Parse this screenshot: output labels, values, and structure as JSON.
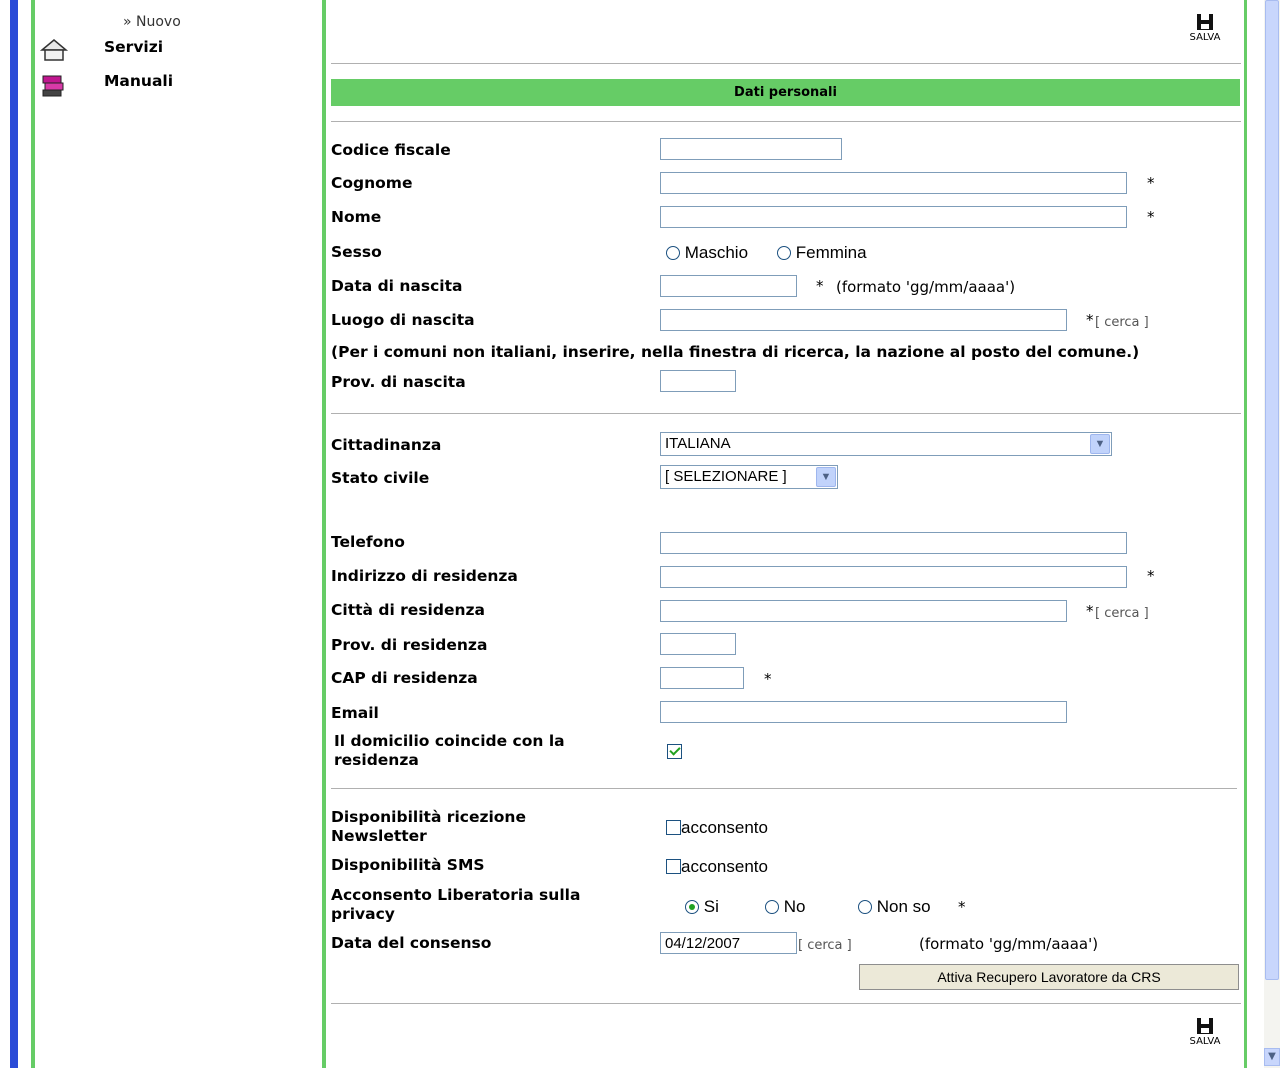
{
  "sidebar": {
    "nuovo": "» Nuovo",
    "servizi": "Servizi",
    "manuali": "Manuali"
  },
  "toolbar": {
    "save_label": "SALVA"
  },
  "section_header": "Dati personali",
  "fields": {
    "codice_fiscale": "Codice fiscale",
    "cognome": "Cognome",
    "nome": "Nome",
    "sesso": "Sesso",
    "maschio": "Maschio",
    "femmina": "Femmina",
    "data_nascita": "Data di nascita",
    "formato": "(formato 'gg/mm/aaaa')",
    "luogo_nascita": "Luogo di nascita",
    "cerca": "[ cerca ]",
    "note_comuni": "(Per i comuni non italiani, inserire, nella finestra di ricerca, la nazione al posto del comune.)",
    "prov_nascita": "Prov. di nascita",
    "cittadinanza": "Cittadinanza",
    "cittadinanza_value": "ITALIANA",
    "stato_civile": "Stato civile",
    "stato_civile_value": "[ SELEZIONARE ]",
    "telefono": "Telefono",
    "indirizzo_residenza": "Indirizzo di residenza",
    "citta_residenza": "Città di residenza",
    "prov_residenza": "Prov. di residenza",
    "cap_residenza": "CAP di residenza",
    "email": "Email",
    "domicilio_line1": "Il domicilio coincide con la",
    "domicilio_line2": "residenza",
    "newsletter_line1": "Disponibilità ricezione",
    "newsletter_line2": "Newsletter",
    "acconsento": "acconsento",
    "sms": "Disponibilità SMS",
    "privacy_line1": "Acconsento Liberatoria sulla",
    "privacy_line2": "privacy",
    "si": "Si",
    "no": "No",
    "non_so": "Non so",
    "data_consenso": "Data del consenso",
    "data_consenso_value": "04/12/2007",
    "required_star": "*"
  },
  "actions": {
    "recupero": "Attiva Recupero Lavoratore da CRS"
  },
  "colors": {
    "section_green": "#66cc66",
    "border_green": "#66cc66",
    "left_blue": "#2040c0"
  }
}
